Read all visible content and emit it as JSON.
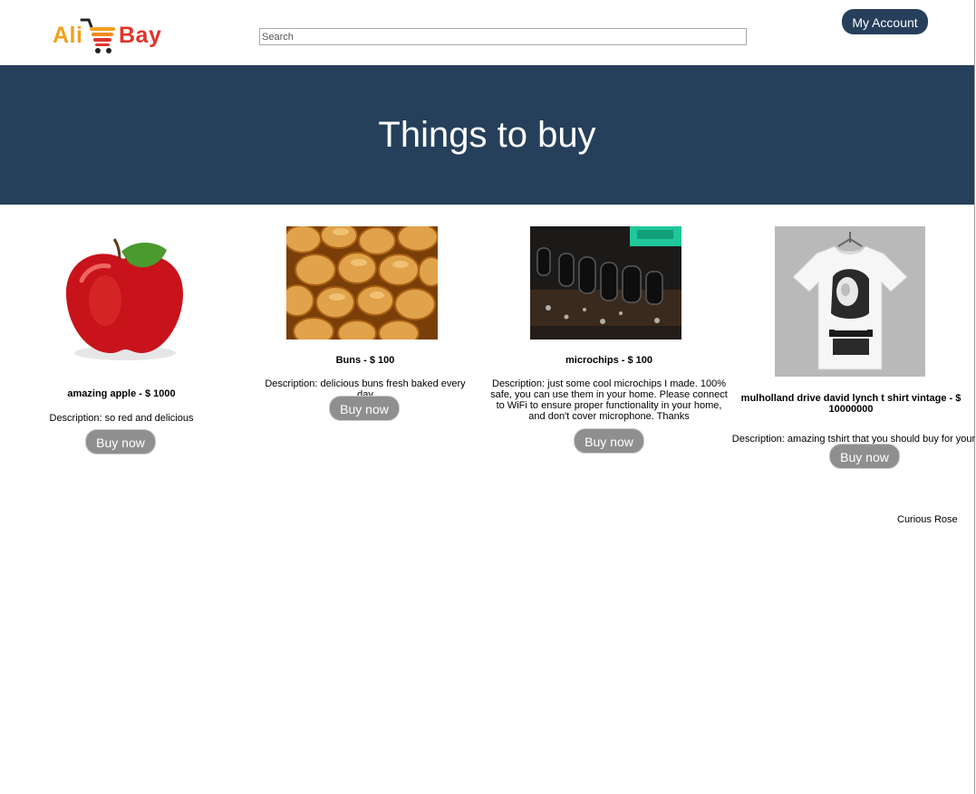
{
  "header": {
    "logo_left": "Ali",
    "logo_right": "Bay",
    "search_placeholder": "Search",
    "account_label": "My Account"
  },
  "hero": {
    "title": "Things to buy"
  },
  "products": [
    {
      "title": "amazing apple - $ 1000",
      "description": "Description: so red and delicious",
      "button": "Buy now",
      "image": "apple"
    },
    {
      "title": "Buns - $ 100",
      "description": "Description: delicious buns fresh baked every day",
      "button": "Buy now",
      "image": "buns"
    },
    {
      "title": "microchips - $ 100",
      "description": "Description: just some cool microchips I made. 100% safe, you can use them in your home. Please connect to WiFi to ensure proper functionality in your home, and don't cover microphone. Thanks",
      "button": "Buy now",
      "image": "circuit board"
    },
    {
      "title": "mulholland drive david lynch t shirt vintage - $ 10000000",
      "description": "Description: amazing tshirt that you should buy for your friend",
      "button": "Buy now",
      "image": "t-shirt"
    }
  ],
  "footer": {
    "name": "Curious Rose"
  },
  "colors": {
    "navy": "#263f5a",
    "button_gray": "#8f8f8f",
    "logo_orange": "#f0a11e",
    "logo_red": "#e0342b"
  }
}
